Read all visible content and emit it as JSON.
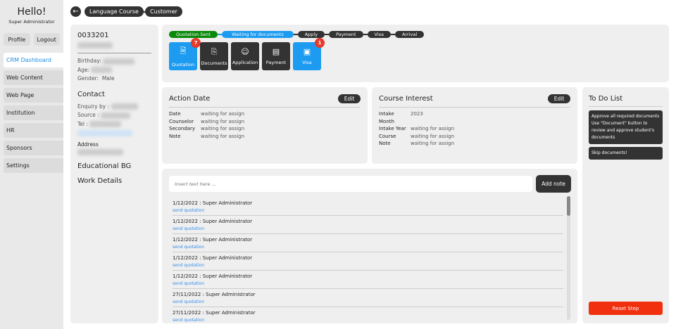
{
  "sidebar": {
    "greeting": "Hello!",
    "role": "Super Administrator",
    "profile": "Profile",
    "logout": "Logout",
    "items": [
      "CRM Dashboard",
      "Web Content",
      "Web Page",
      "Institution",
      "HR",
      "Sponsors",
      "Settings"
    ]
  },
  "breadcrumb": [
    "Language Course",
    "Customer"
  ],
  "profile": {
    "id": "0033201",
    "birthday": "Birthday:",
    "age": "Age:",
    "gender_label": "Gender:",
    "gender": "Male",
    "contact": "Contact",
    "enquiry": "Enquiry by :",
    "source": "Source :",
    "tel": "Tel :",
    "address": "Address",
    "edu": "Educational BG",
    "work": "Work Details"
  },
  "steps": [
    "Quotation Sent",
    "Waiting for documents",
    "Apply",
    "Payment",
    "Visa",
    "Arrival"
  ],
  "step_colors": {
    "done": "#0a8a0a",
    "current": "#1c9bf0",
    "pending": "#333333"
  },
  "tiles": [
    {
      "label": "Quotation",
      "badge": "7"
    },
    {
      "label": "Documents"
    },
    {
      "label": "Application"
    },
    {
      "label": "Payment"
    },
    {
      "label": "Visa",
      "badge": "1"
    }
  ],
  "action": {
    "title": "Action Date",
    "edit": "Edit",
    "rows": [
      [
        "Date",
        "waiting for assign"
      ],
      [
        "Counselor",
        "waiting for assign"
      ],
      [
        "Secondary",
        "waiting for assign"
      ],
      [
        "Note",
        "waiting for assign"
      ]
    ]
  },
  "course": {
    "title": "Course Interest",
    "edit": "Edit",
    "rows": [
      [
        "Intake Month",
        "2023"
      ],
      [
        "Intake Year",
        "waiting for assign"
      ],
      [
        "Course",
        "waiting for assign"
      ],
      [
        "Note",
        "waiting for assign"
      ]
    ]
  },
  "todo": {
    "title": "To Do List",
    "items": [
      "Approve all required documents Use \"Document\" button to review and approve student's documents",
      "Skip documents!"
    ],
    "reset": "Reset Step"
  },
  "notes": {
    "placeholder": "Insert text here ...",
    "add": "Add note",
    "items": [
      {
        "t": "1/12/2022 : Super Administrator",
        "s": "send quotation"
      },
      {
        "t": "1/12/2022 : Super Administrator",
        "s": "send quotation"
      },
      {
        "t": "1/12/2022 : Super Administrator",
        "s": "send quotation"
      },
      {
        "t": "1/12/2022 : Super Administrator",
        "s": "send quotation"
      },
      {
        "t": "1/12/2022 : Super Administrator",
        "s": "send quotation"
      },
      {
        "t": "27/11/2022 : Super Administrator",
        "s": "send quotation"
      },
      {
        "t": "27/11/2022 : Super Administrator",
        "s": "send quotation"
      }
    ]
  }
}
